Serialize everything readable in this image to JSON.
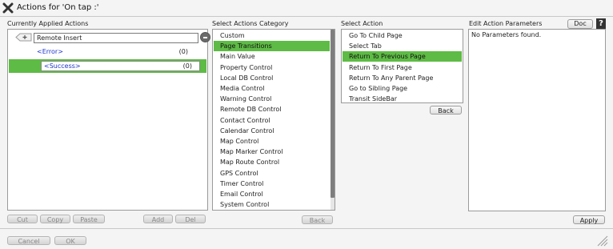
{
  "window": {
    "title": "Actions for 'On tap :'"
  },
  "applied": {
    "header": "Currently Applied Actions",
    "insert_value": "Remote Insert",
    "error_label": "<Error>",
    "error_count": "(0)",
    "success_label": "<Success>",
    "success_count": "(0)",
    "buttons": {
      "cut": "Cut",
      "copy": "Copy",
      "paste": "Paste",
      "add": "Add",
      "del": "Del"
    }
  },
  "category": {
    "header": "Select Actions Category",
    "items": [
      "Custom",
      "Page Transitions",
      "Main Value",
      "Property Control",
      "Local DB Control",
      "Media Control",
      "Warning Control",
      "Remote DB Control",
      "Contact Control",
      "Calendar Control",
      "Map Control",
      "Map Marker Control",
      "Map Route Control",
      "GPS Control",
      "Timer Control",
      "Email Control",
      "System Control"
    ],
    "selected_index": 1,
    "back_label": "Back"
  },
  "action": {
    "header": "Select Action",
    "items": [
      "Go To Child Page",
      "Select Tab",
      "Return To Previous Page",
      "Return To First Page",
      "Return To Any Parent Page",
      "Go to Sibling Page",
      "Transit SideBar"
    ],
    "selected_index": 2,
    "back_label": "Back"
  },
  "params": {
    "header": "Edit Action Parameters",
    "doc_label": "Doc",
    "help_glyph": "?",
    "empty_text": "No Parameters found.",
    "apply_label": "Apply"
  },
  "footer": {
    "cancel_label": "Cancel",
    "ok_label": "OK"
  },
  "colors": {
    "selection": "#5ebb45",
    "tree_link": "#1d35c9"
  },
  "icons": {
    "close": "close-icon",
    "plus": "add-node-icon",
    "minus": "remove-icon",
    "help": "help-icon",
    "grip": "resize-grip-icon"
  }
}
